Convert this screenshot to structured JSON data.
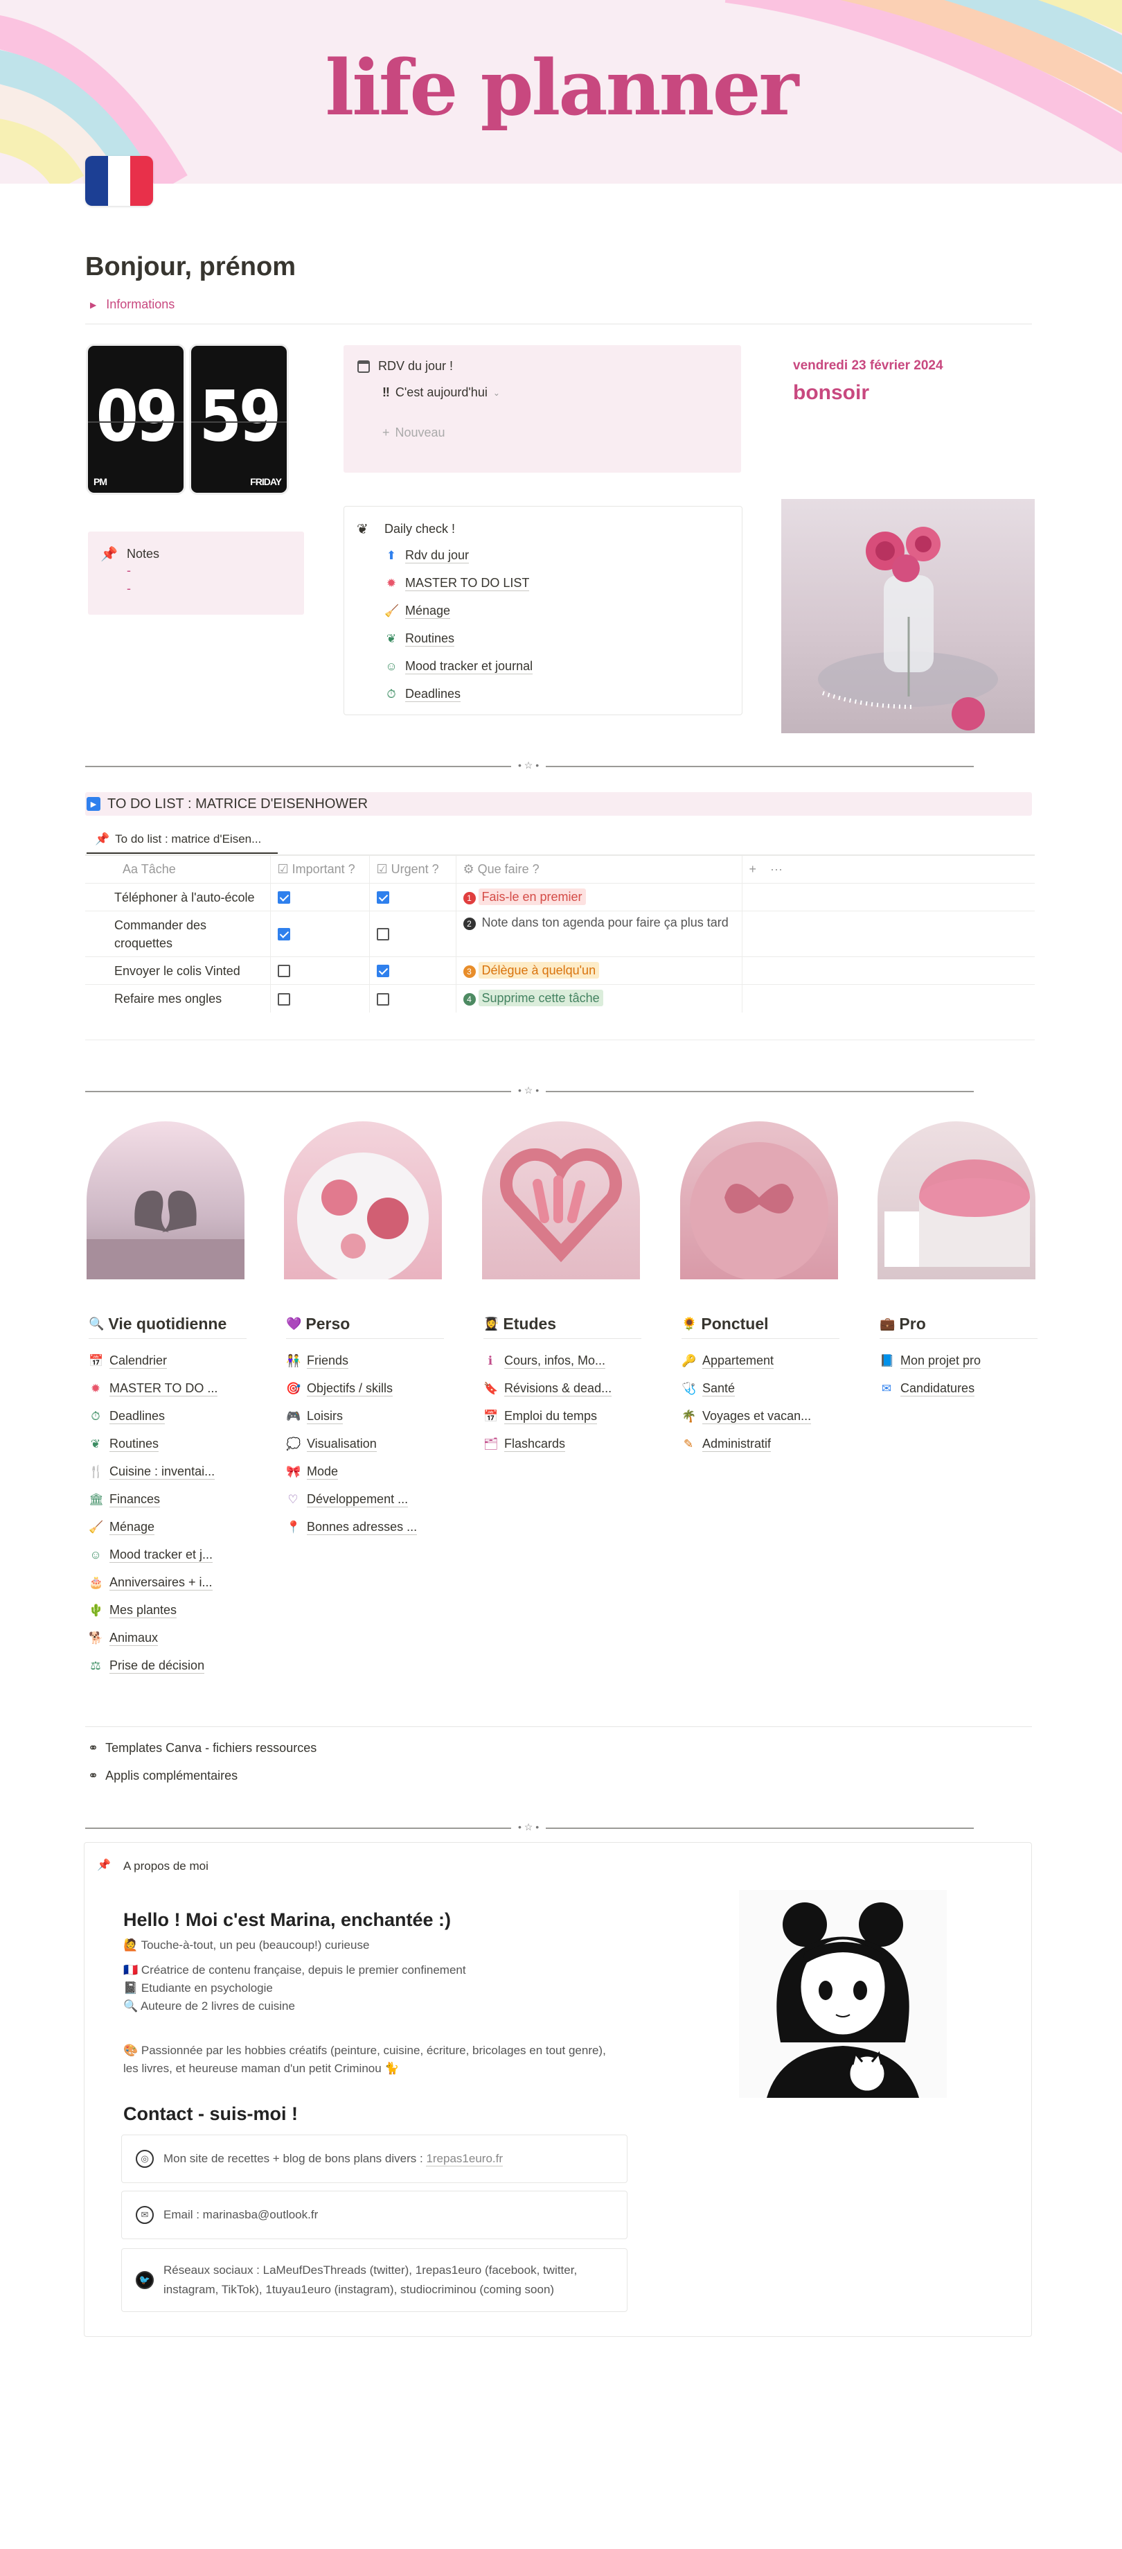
{
  "banner": {
    "title": "life planner"
  },
  "greeting": {
    "title": "Bonjour, prénom",
    "toggle_label": "Informations"
  },
  "clock": {
    "hours": "09",
    "minutes": "59",
    "period": "PM",
    "day": "FRIDAY"
  },
  "rdv": {
    "title": "RDV du jour !",
    "view_label": "C'est aujourd'hui",
    "new_label": "Nouveau"
  },
  "date": {
    "date_text": "vendredi 23 février 2024",
    "greeting_text": "bonsoir"
  },
  "notes": {
    "title": "Notes",
    "line1": "-",
    "line2": "-"
  },
  "daily_check": {
    "title": "Daily check !",
    "items": [
      "Rdv du jour",
      "MASTER TO DO LIST",
      "Ménage",
      "Routines",
      "Mood tracker et journal",
      "Deadlines"
    ]
  },
  "todo": {
    "callout_title": "TO DO LIST : MATRICE D'EISENHOWER",
    "view_tab": "To do list : matrice d'Eisen...",
    "columns": {
      "task": "Tâche",
      "important": "Important ?",
      "urgent": "Urgent ?",
      "action": "Que faire ?"
    },
    "rows": [
      {
        "task": "Téléphoner à l'auto-école",
        "important": true,
        "urgent": true,
        "action": "Fais-le en premier",
        "num": "1"
      },
      {
        "task": "Commander des croquettes",
        "important": true,
        "urgent": false,
        "action": "Note dans ton agenda pour faire ça plus tard",
        "num": "2"
      },
      {
        "task": "Envoyer le colis Vinted",
        "important": false,
        "urgent": true,
        "action": "Délègue à quelqu'un",
        "num": "3"
      },
      {
        "task": "Refaire mes ongles",
        "important": false,
        "urgent": false,
        "action": "Supprime cette tâche",
        "num": "4"
      }
    ]
  },
  "categories": [
    {
      "title": "Vie quotidienne",
      "items": [
        "Calendrier",
        "MASTER TO DO ...",
        "Deadlines",
        "Routines",
        "Cuisine : inventai...",
        "Finances",
        "Ménage",
        "Mood tracker et j...",
        "Anniversaires + i...",
        "Mes plantes",
        "Animaux",
        "Prise de décision"
      ]
    },
    {
      "title": "Perso",
      "items": [
        "Friends",
        "Objectifs / skills",
        "Loisirs",
        "Visualisation",
        "Mode",
        "Développement ...",
        "Bonnes adresses ..."
      ]
    },
    {
      "title": "Etudes",
      "items": [
        "Cours, infos, Mo...",
        "Révisions & dead...",
        "Emploi du temps",
        "Flashcards"
      ]
    },
    {
      "title": "Ponctuel",
      "items": [
        "Appartement",
        "Santé",
        "Voyages et vacan...",
        "Administratif"
      ]
    },
    {
      "title": "Pro",
      "items": [
        "Mon projet pro",
        "Candidatures"
      ]
    }
  ],
  "resources": {
    "canva": "Templates Canva - fichiers ressources",
    "apps": "Applis complémentaires"
  },
  "about": {
    "title": "A propos de moi",
    "hello": "Hello ! Moi c'est Marina, enchantée :)",
    "line1": "Touche-à-tout, un peu (beaucoup!) curieuse",
    "line2": "Créatrice de contenu française, depuis le premier confinement",
    "line3": "Etudiante en psychologie",
    "line4": "Auteure de 2 livres de cuisine",
    "line5": "Passionnée par les hobbies créatifs (peinture, cuisine, écriture, bricolages en tout genre),",
    "line6": "les livres, et heureuse maman d'un petit Criminou",
    "contact_title": "Contact - suis-moi !",
    "site_prefix": "Mon site de recettes + blog de bons plans divers :",
    "site_link": "1repas1euro.fr",
    "email": "Email : marinasba@outlook.fr",
    "social1": "Réseaux sociaux : LaMeufDesThreads (twitter), 1repas1euro (facebook, twitter,",
    "social2": "instagram, TikTok), 1tuyau1euro (instagram), studiocriminou (coming soon)"
  },
  "colors": {
    "accent": "#c8487f",
    "callout_bg": "#f9edf2",
    "checkbox": "#2f80ed"
  }
}
